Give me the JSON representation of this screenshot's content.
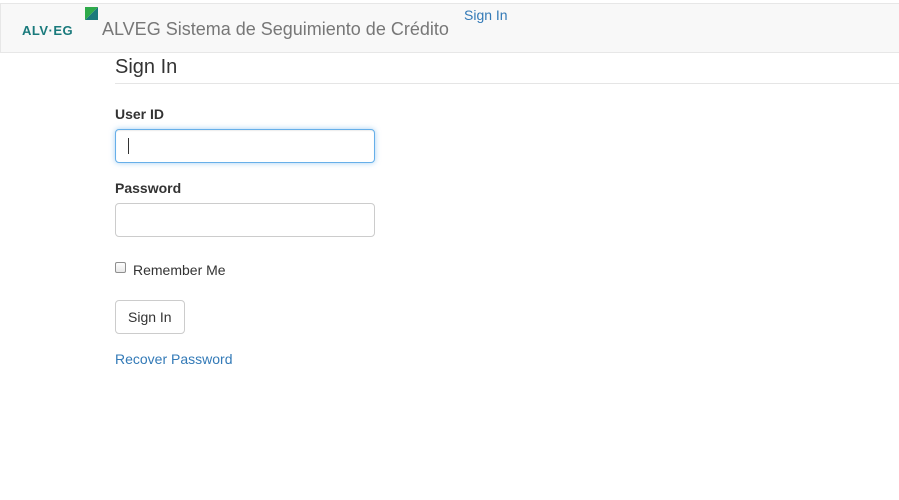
{
  "navbar": {
    "logo_text": "ALV·EG",
    "brand": "ALVEG Sistema de Seguimiento de Crédito",
    "signin_link": "Sign In"
  },
  "form": {
    "title": "Sign In",
    "user_id_label": "User ID",
    "user_id_value": "",
    "password_label": "Password",
    "password_value": "",
    "remember_label": "Remember Me",
    "remember_checked": false,
    "submit_label": "Sign In",
    "recover_link": "Recover Password"
  },
  "colors": {
    "link": "#337ab7",
    "logo_teal": "#1a7a7c",
    "logo_green": "#2eaa4a",
    "focus_border": "#66afe9"
  }
}
